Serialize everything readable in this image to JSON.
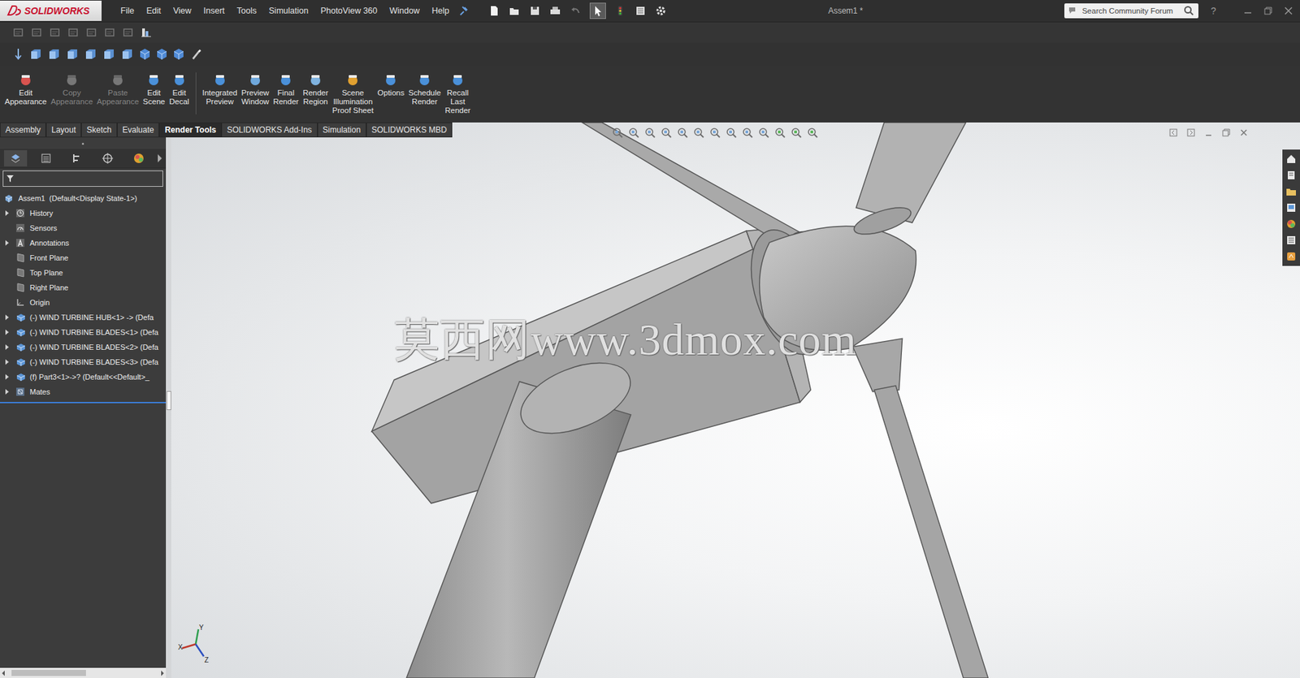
{
  "window": {
    "title": "Assem1 *"
  },
  "logo": "SOLIDWORKS",
  "menu": [
    "File",
    "Edit",
    "View",
    "Insert",
    "Tools",
    "Simulation",
    "PhotoView 360",
    "Window",
    "Help"
  ],
  "search": {
    "placeholder": "Search Community Forum"
  },
  "help": "?",
  "command_buttons": [
    {
      "lines": [
        "Edit",
        "Appearance"
      ],
      "disabled": false,
      "group": 1
    },
    {
      "lines": [
        "Copy",
        "Appearance"
      ],
      "disabled": true,
      "group": 1
    },
    {
      "lines": [
        "Paste",
        "Appearance"
      ],
      "disabled": true,
      "group": 1
    },
    {
      "lines": [
        "Edit",
        "Scene"
      ],
      "disabled": false,
      "group": 1
    },
    {
      "lines": [
        "Edit",
        "Decal"
      ],
      "disabled": false,
      "group": 1
    },
    {
      "lines": [
        "Integrated",
        "Preview"
      ],
      "disabled": false,
      "group": 2
    },
    {
      "lines": [
        "Preview",
        "Window"
      ],
      "disabled": false,
      "group": 2
    },
    {
      "lines": [
        "Final",
        "Render"
      ],
      "disabled": false,
      "group": 2
    },
    {
      "lines": [
        "Render",
        "Region"
      ],
      "disabled": false,
      "group": 2
    },
    {
      "lines": [
        "Scene",
        "Illumination",
        "Proof Sheet"
      ],
      "disabled": false,
      "group": 2
    },
    {
      "lines": [
        "Options"
      ],
      "disabled": false,
      "group": 2
    },
    {
      "lines": [
        "Schedule",
        "Render"
      ],
      "disabled": false,
      "group": 2
    },
    {
      "lines": [
        "Recall",
        "Last",
        "Render"
      ],
      "disabled": false,
      "group": 2
    }
  ],
  "tabs": [
    {
      "label": "Assembly",
      "selected": false
    },
    {
      "label": "Layout",
      "selected": false
    },
    {
      "label": "Sketch",
      "selected": false
    },
    {
      "label": "Evaluate",
      "selected": false
    },
    {
      "label": "Render Tools",
      "selected": true
    },
    {
      "label": "SOLIDWORKS Add-Ins",
      "selected": false
    },
    {
      "label": "Simulation",
      "selected": false
    },
    {
      "label": "SOLIDWORKS MBD",
      "selected": false
    }
  ],
  "feature_tree": {
    "root": "Assem1  (Default<Display State-1>)",
    "items": [
      {
        "label": "History",
        "kind": "history",
        "expandable": true
      },
      {
        "label": "Sensors",
        "kind": "sensors",
        "expandable": false
      },
      {
        "label": "Annotations",
        "kind": "annotations",
        "expandable": true
      },
      {
        "label": "Front Plane",
        "kind": "plane",
        "expandable": false
      },
      {
        "label": "Top Plane",
        "kind": "plane",
        "expandable": false
      },
      {
        "label": "Right Plane",
        "kind": "plane",
        "expandable": false
      },
      {
        "label": "Origin",
        "kind": "origin",
        "expandable": false
      },
      {
        "label": "(-) WIND TURBINE HUB<1> -> (Defa",
        "kind": "component",
        "expandable": true
      },
      {
        "label": "(-) WIND TURBINE BLADES<1> (Defa",
        "kind": "component",
        "expandable": true
      },
      {
        "label": "(-) WIND TURBINE BLADES<2> (Defa",
        "kind": "component",
        "expandable": true
      },
      {
        "label": "(-) WIND TURBINE BLADES<3> (Defa",
        "kind": "component",
        "expandable": true
      },
      {
        "label": "(f) Part3<1>->? (Default<<Default>_",
        "kind": "component",
        "expandable": true
      },
      {
        "label": "Mates",
        "kind": "mates",
        "expandable": true
      }
    ]
  },
  "watermark": "莫西网www.3dmox.com",
  "triad": {
    "x": "X",
    "y": "Y",
    "z": "Z"
  }
}
